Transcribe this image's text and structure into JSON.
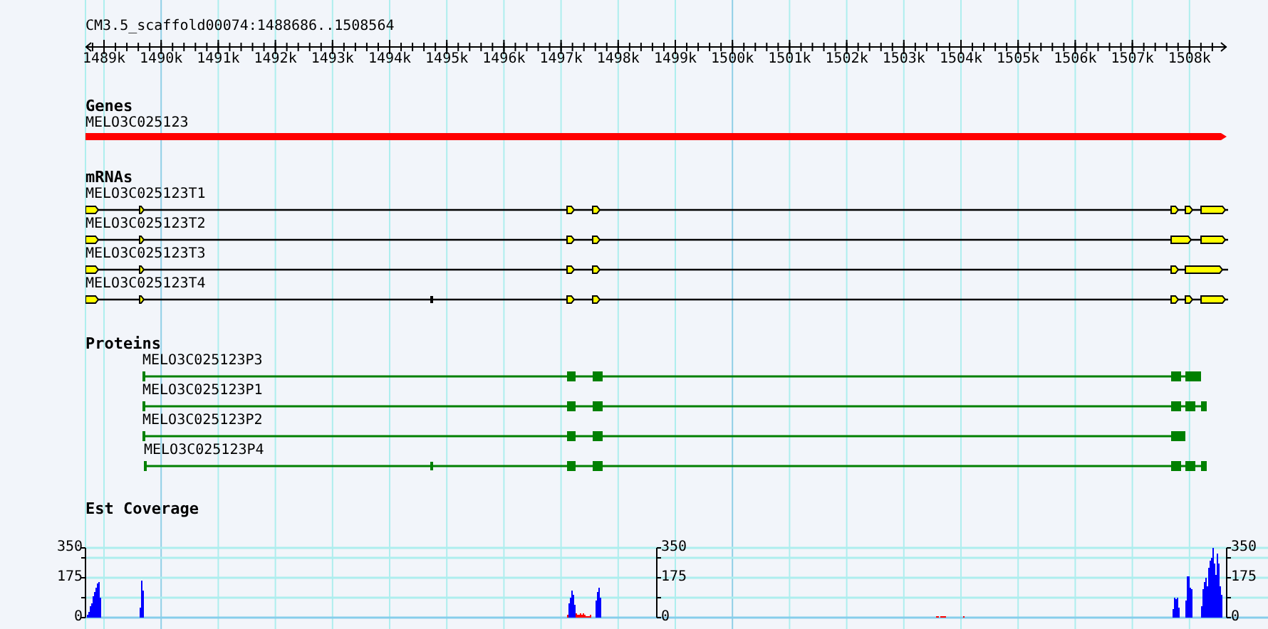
{
  "ruler": {
    "title": "CM3.5_scaffold00074:1488686..1508564",
    "labels": [
      "1489k",
      "1490k",
      "1491k",
      "1492k",
      "1493k",
      "1494k",
      "1495k",
      "1496k",
      "1497k",
      "1498k",
      "1499k",
      "1500k",
      "1501k",
      "1502k",
      "1503k",
      "1504k",
      "1505k",
      "1506k",
      "1507k",
      "1508k"
    ]
  },
  "tracks": [
    {
      "kind": "gene",
      "title": "Genes",
      "features": [
        {
          "label": "MELO3C025123"
        }
      ]
    },
    {
      "kind": "mrna",
      "title": "mRNAs",
      "features": [
        {
          "label": "MELO3C025123T1"
        },
        {
          "label": "MELO3C025123T2"
        },
        {
          "label": "MELO3C025123T3"
        },
        {
          "label": "MELO3C025123T4"
        }
      ]
    },
    {
      "kind": "protein",
      "title": "Proteins",
      "features": [
        {
          "label": "MELO3C025123P3"
        },
        {
          "label": "MELO3C025123P1"
        },
        {
          "label": "MELO3C025123P2"
        },
        {
          "label": "MELO3C025123P4"
        }
      ]
    },
    {
      "kind": "coverage",
      "title": "Est Coverage",
      "axes": [
        {
          "ticks": [
            "350",
            "175",
            "0"
          ]
        },
        {
          "ticks": [
            "350",
            "175",
            "0"
          ]
        },
        {
          "ticks": [
            "350",
            "175",
            "0"
          ]
        }
      ]
    }
  ]
}
